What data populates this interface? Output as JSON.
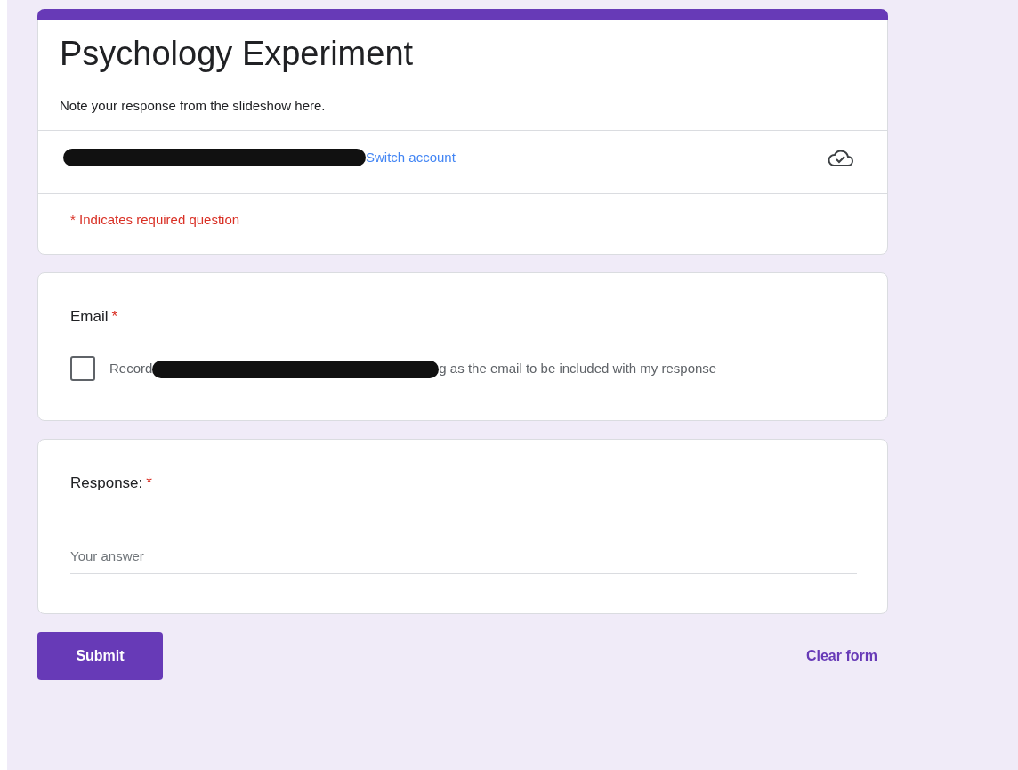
{
  "form": {
    "title": "Psychology Experiment",
    "description": "Note your response from the slideshow here.",
    "account": {
      "redacted": true,
      "switch_link": "Switch account"
    },
    "required_note": "* Indicates required question"
  },
  "questions": [
    {
      "kind": "email",
      "label": "Email",
      "required_mark": "*",
      "checkbox": {
        "text_before": "Record",
        "redacted": true,
        "text_after": "g as the email to be included with my response",
        "checked": false
      }
    },
    {
      "kind": "text",
      "label": "Response:",
      "required_mark": "*",
      "placeholder": "Your answer"
    }
  ],
  "actions": {
    "submit": "Submit",
    "clear": "Clear form"
  }
}
